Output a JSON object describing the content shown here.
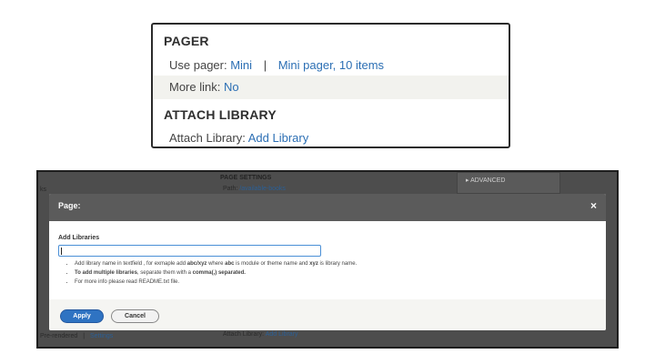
{
  "top_panel": {
    "pager_heading": "PAGER",
    "use_pager_label": "Use pager:",
    "use_pager_value": "Mini",
    "separator": "|",
    "mini_pager_value": "Mini pager, 10 items",
    "more_link_label": "More link:",
    "more_link_value": "No",
    "attach_heading": "ATTACH LIBRARY",
    "attach_label": "Attach Library:",
    "attach_value": "Add Library"
  },
  "background": {
    "page_settings": "PAGE SETTINGS",
    "path_label": "Path:",
    "path_value": "/available-books",
    "advanced": "▸ ADVANCED",
    "left_fragment": "ks",
    "footer_left": "Pre-rendered",
    "footer_sep": "|",
    "footer_settings": "Settings",
    "attach_label": "Attach Library:",
    "attach_value": "Add Library"
  },
  "dialog": {
    "title": "Page:",
    "close_glyph": "×",
    "field_label": "Add Libraries",
    "input_value": "",
    "help": {
      "item1": {
        "t1": "Add library name in textfield , for exmaple add ",
        "b1": "abc/xyz",
        "t2": " where ",
        "b2": "abc",
        "t3": " is module or theme name and ",
        "b3": "xyz",
        "t4": " is library name."
      },
      "item2": {
        "b1": "To add multiple libraries",
        "t1": ", separate them with a ",
        "b2": "comma(,) separated."
      },
      "item3": "For more info please read README.txt file."
    },
    "apply_label": "Apply",
    "cancel_label": "Cancel"
  }
}
